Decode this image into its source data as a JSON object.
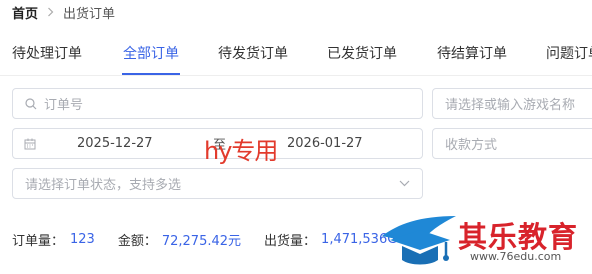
{
  "breadcrumb": {
    "home": "首页",
    "current": "出货订单"
  },
  "tabs": [
    {
      "label": "待处理订单"
    },
    {
      "label": "全部订单"
    },
    {
      "label": "待发货订单"
    },
    {
      "label": "已发货订单"
    },
    {
      "label": "待结算订单"
    },
    {
      "label": "问题订单"
    }
  ],
  "active_tab": "全部订单",
  "filters": {
    "order_no": {
      "placeholder": "订单号",
      "icon": "search-icon"
    },
    "game": {
      "placeholder": "请选择或输入游戏名称"
    },
    "date_range": {
      "start": "2025-12-27",
      "separator": "至",
      "end": "2026-01-27",
      "icon": "calendar-icon"
    },
    "payment": {
      "placeholder": "收款方式"
    },
    "status": {
      "placeholder": "请选择订单状态，支持多选",
      "icon": "chevron-down-icon"
    }
  },
  "stats": {
    "order_count_label": "订单量：",
    "order_count_value": "123",
    "amount_label": "金额：",
    "amount_value": "72,275.42元",
    "volume_label": "出货量：",
    "volume_value": "1,471,536G"
  },
  "watermark": {
    "text": "hy专用",
    "color": "#e23a2c"
  },
  "logo": {
    "text": "其乐教育",
    "url": "www.76edu.com",
    "color": "#d8232b"
  },
  "colors": {
    "accent": "#3a64e6",
    "border": "#dcdfe6",
    "placeholder": "#a8abb2"
  }
}
